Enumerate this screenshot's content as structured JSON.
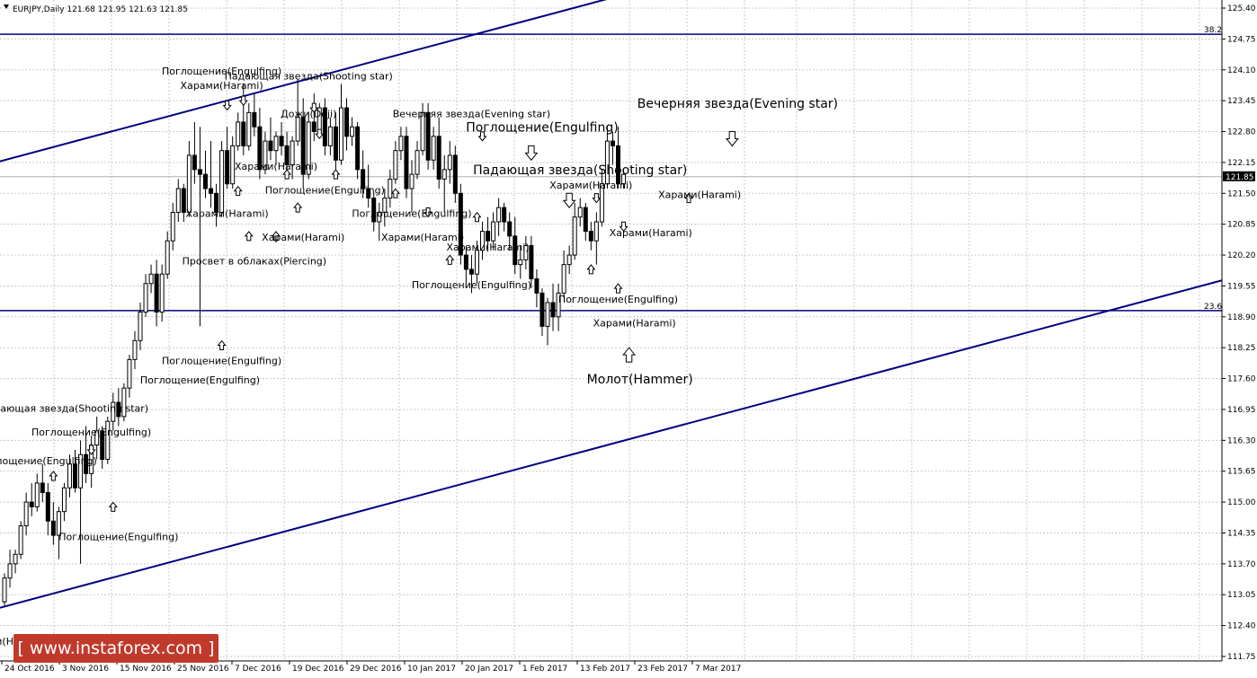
{
  "header": {
    "symbol_info": "EURJPY,Daily  121.68 121.95 121.63 121.85"
  },
  "watermark": {
    "text": "[ www.instaforex.com ]"
  },
  "colors": {
    "trendline": "#000080",
    "price_tag_bg": "#000000",
    "price_tag_fg": "#ffffff",
    "candle_up": "#ffffff",
    "candle_down": "#000000",
    "watermark_bg": "#c0392b"
  },
  "chart_data": {
    "type": "candlestick",
    "title": "",
    "ylim": [
      111.7,
      125.5
    ],
    "y_ticks": [
      "125.40",
      "124.75",
      "124.10",
      "123.45",
      "122.80",
      "122.15",
      "121.50",
      "120.85",
      "120.20",
      "119.55",
      "118.90",
      "118.25",
      "117.60",
      "116.95",
      "116.30",
      "115.65",
      "115.00",
      "114.35",
      "113.70",
      "113.05",
      "112.40",
      "111.75"
    ],
    "x_ticks": [
      "24 Oct 2016",
      "3 Nov 2016",
      "15 Nov 2016",
      "25 Nov 2016",
      "7 Dec 2016",
      "19 Dec 2016",
      "29 Dec 2016",
      "10 Jan 2017",
      "20 Jan 2017",
      "1 Feb 2017",
      "13 Feb 2017",
      "23 Feb 2017",
      "7 Mar 2017"
    ],
    "current_price": "121.85",
    "fib_levels": [
      {
        "label": "38.2",
        "price": 124.85
      },
      {
        "label": "23.6",
        "price": 119.03
      }
    ],
    "trend_channel": {
      "upper": [
        [
          0,
          122.2
        ],
        [
          108,
          125.5
        ]
      ],
      "lower": [
        [
          0,
          112.8
        ],
        [
          204,
          119.05
        ]
      ]
    },
    "candles": [
      [
        112.9,
        113.5,
        112.8,
        113.4
      ],
      [
        113.4,
        114.0,
        113.2,
        113.7
      ],
      [
        113.7,
        114.0,
        113.5,
        113.9
      ],
      [
        113.9,
        114.6,
        113.8,
        114.5
      ],
      [
        114.5,
        115.2,
        114.3,
        115.0
      ],
      [
        115.0,
        115.4,
        114.7,
        114.9
      ],
      [
        114.9,
        115.6,
        114.8,
        115.4
      ],
      [
        115.4,
        115.8,
        115.0,
        115.2
      ],
      [
        115.2,
        115.4,
        114.3,
        114.6
      ],
      [
        114.6,
        115.0,
        114.1,
        114.3
      ],
      [
        114.3,
        114.9,
        113.8,
        114.8
      ],
      [
        114.8,
        115.4,
        114.6,
        115.3
      ],
      [
        115.3,
        116.0,
        115.1,
        115.8
      ],
      [
        115.8,
        116.1,
        115.2,
        115.3
      ],
      [
        115.3,
        116.3,
        113.7,
        116.0
      ],
      [
        116.0,
        116.6,
        115.4,
        115.6
      ],
      [
        115.6,
        116.4,
        115.3,
        116.2
      ],
      [
        116.2,
        116.8,
        115.9,
        116.5
      ],
      [
        116.5,
        116.6,
        115.7,
        115.9
      ],
      [
        115.9,
        116.8,
        115.8,
        116.7
      ],
      [
        116.7,
        117.3,
        116.5,
        117.1
      ],
      [
        117.1,
        117.4,
        116.6,
        116.8
      ],
      [
        116.8,
        117.5,
        116.7,
        117.4
      ],
      [
        117.4,
        118.1,
        117.2,
        118.0
      ],
      [
        118.0,
        118.6,
        117.8,
        118.4
      ],
      [
        118.4,
        119.2,
        118.2,
        119.0
      ],
      [
        119.0,
        119.8,
        118.9,
        119.6
      ],
      [
        119.6,
        120.0,
        119.4,
        119.8
      ],
      [
        119.8,
        120.1,
        118.7,
        119.0
      ],
      [
        119.0,
        120.0,
        118.8,
        119.8
      ],
      [
        119.8,
        120.7,
        119.7,
        120.5
      ],
      [
        120.5,
        121.3,
        120.3,
        121.1
      ],
      [
        121.1,
        121.8,
        120.9,
        121.6
      ],
      [
        121.6,
        121.7,
        120.9,
        121.1
      ],
      [
        121.1,
        122.6,
        121.0,
        122.3
      ],
      [
        122.3,
        123.0,
        121.7,
        122.0
      ],
      [
        122.0,
        122.9,
        118.7,
        121.9
      ],
      [
        121.9,
        122.4,
        121.4,
        121.6
      ],
      [
        121.6,
        122.6,
        121.2,
        121.5
      ],
      [
        121.5,
        121.7,
        120.8,
        121.1
      ],
      [
        121.1,
        122.6,
        121.0,
        122.4
      ],
      [
        122.4,
        122.9,
        121.6,
        121.7
      ],
      [
        121.7,
        122.7,
        121.6,
        122.5
      ],
      [
        122.5,
        123.2,
        122.4,
        123.0
      ],
      [
        123.0,
        123.8,
        122.3,
        122.5
      ],
      [
        122.5,
        123.4,
        122.4,
        123.2
      ],
      [
        123.2,
        123.6,
        122.7,
        122.9
      ],
      [
        122.9,
        123.3,
        121.8,
        122.0
      ],
      [
        122.0,
        122.8,
        121.9,
        122.6
      ],
      [
        122.6,
        123.1,
        122.2,
        122.4
      ],
      [
        122.4,
        122.8,
        122.1,
        122.7
      ],
      [
        122.7,
        123.0,
        122.3,
        122.5
      ],
      [
        122.5,
        122.8,
        121.9,
        122.1
      ],
      [
        122.1,
        122.7,
        121.8,
        122.6
      ],
      [
        122.6,
        123.9,
        122.5,
        123.1
      ],
      [
        123.1,
        123.5,
        121.6,
        121.9
      ],
      [
        121.9,
        123.2,
        121.8,
        123.0
      ],
      [
        123.0,
        123.6,
        122.6,
        122.8
      ],
      [
        122.8,
        123.4,
        122.7,
        123.3
      ],
      [
        123.3,
        123.5,
        122.3,
        122.5
      ],
      [
        122.5,
        123.1,
        122.3,
        122.9
      ],
      [
        122.9,
        123.2,
        122.0,
        122.2
      ],
      [
        122.2,
        123.8,
        122.1,
        123.3
      ],
      [
        123.3,
        123.5,
        122.4,
        122.7
      ],
      [
        122.7,
        123.1,
        122.5,
        122.9
      ],
      [
        122.9,
        123.0,
        121.8,
        122.0
      ],
      [
        122.0,
        122.4,
        121.4,
        121.6
      ],
      [
        121.6,
        122.1,
        121.2,
        121.4
      ],
      [
        121.4,
        121.5,
        120.7,
        120.9
      ],
      [
        120.9,
        121.3,
        120.5,
        121.1
      ],
      [
        121.1,
        121.6,
        120.8,
        121.4
      ],
      [
        121.4,
        122.0,
        121.2,
        121.8
      ],
      [
        121.8,
        122.6,
        121.7,
        122.4
      ],
      [
        122.4,
        122.9,
        122.2,
        122.7
      ],
      [
        122.7,
        122.9,
        121.4,
        121.6
      ],
      [
        121.6,
        122.2,
        121.1,
        121.9
      ],
      [
        121.9,
        122.6,
        121.8,
        122.4
      ],
      [
        122.4,
        123.4,
        122.3,
        123.2
      ],
      [
        123.2,
        123.4,
        122.0,
        122.2
      ],
      [
        122.2,
        122.9,
        122.0,
        122.7
      ],
      [
        122.7,
        123.1,
        121.6,
        121.8
      ],
      [
        121.8,
        122.3,
        121.1,
        122.0
      ],
      [
        122.0,
        122.6,
        121.7,
        122.3
      ],
      [
        122.3,
        122.5,
        121.3,
        121.5
      ],
      [
        121.5,
        121.7,
        120.0,
        120.2
      ],
      [
        120.2,
        120.4,
        119.6,
        119.9
      ],
      [
        119.9,
        120.2,
        119.4,
        119.8
      ],
      [
        119.8,
        120.5,
        119.6,
        120.3
      ],
      [
        120.3,
        120.9,
        120.1,
        120.7
      ],
      [
        120.7,
        121.0,
        120.3,
        120.5
      ],
      [
        120.5,
        121.1,
        120.3,
        120.9
      ],
      [
        120.9,
        121.4,
        120.6,
        121.2
      ],
      [
        121.2,
        121.3,
        120.7,
        120.9
      ],
      [
        120.9,
        121.1,
        120.3,
        120.6
      ],
      [
        120.6,
        121.0,
        119.8,
        120.0
      ],
      [
        120.0,
        120.4,
        119.7,
        120.1
      ],
      [
        120.1,
        120.6,
        119.9,
        120.4
      ],
      [
        120.4,
        120.6,
        119.5,
        119.7
      ],
      [
        119.7,
        119.9,
        119.1,
        119.4
      ],
      [
        119.4,
        119.5,
        118.5,
        118.7
      ],
      [
        118.7,
        119.3,
        118.3,
        119.2
      ],
      [
        119.2,
        119.6,
        118.6,
        118.9
      ],
      [
        118.9,
        119.6,
        118.6,
        119.4
      ],
      [
        119.4,
        120.3,
        119.3,
        120.0
      ],
      [
        120.0,
        120.4,
        119.8,
        120.2
      ],
      [
        120.2,
        121.3,
        120.1,
        121.0
      ],
      [
        121.0,
        121.4,
        120.8,
        121.2
      ],
      [
        121.2,
        121.3,
        120.5,
        120.7
      ],
      [
        120.7,
        120.9,
        120.3,
        120.5
      ],
      [
        120.5,
        121.1,
        120.0,
        120.9
      ],
      [
        120.9,
        122.0,
        120.8,
        121.7
      ],
      [
        121.7,
        122.9,
        121.6,
        122.6
      ],
      [
        122.6,
        122.8,
        122.1,
        122.5
      ],
      [
        122.5,
        122.9,
        121.6,
        121.7
      ],
      [
        121.7,
        122.0,
        121.6,
        121.9
      ]
    ],
    "annotations": [
      {
        "text": "Поглощение(Engulfing)",
        "candle": 40,
        "price": 124.0,
        "size": "small"
      },
      {
        "text": "Харами(Harami)",
        "candle": 40,
        "price": 123.7,
        "size": "small"
      },
      {
        "text": "Падающая звезда(Shooting star)",
        "candle": 56,
        "price": 123.9,
        "size": "small"
      },
      {
        "text": "Дожи(Doji)",
        "candle": 56,
        "price": 123.1,
        "size": "small"
      },
      {
        "text": "Вечерняя звезда(Evening star)",
        "candle": 86,
        "price": 123.1,
        "size": "small"
      },
      {
        "text": "Поглощение(Engulfing)",
        "candle": 99,
        "price": 122.8,
        "size": "big"
      },
      {
        "text": "Вечерняя звезда(Evening star)",
        "candle": 135,
        "price": 123.3,
        "size": "big"
      },
      {
        "text": "Падающая звезда(Shooting star)",
        "candle": 106,
        "price": 121.9,
        "size": "big"
      },
      {
        "text": "Харами(Harami)",
        "candle": 50,
        "price": 122.0,
        "size": "small"
      },
      {
        "text": "Харами(Harami)",
        "candle": 108,
        "price": 121.6,
        "size": "small"
      },
      {
        "text": "Харами(Harami)",
        "candle": 128,
        "price": 121.4,
        "size": "small"
      },
      {
        "text": "Поглощение(Engulfing)",
        "candle": 59,
        "price": 121.5,
        "size": "small"
      },
      {
        "text": "Харами(Harami)",
        "candle": 41,
        "price": 121.0,
        "size": "small"
      },
      {
        "text": "Поглощение(Engulfing)",
        "candle": 75,
        "price": 121.0,
        "size": "small"
      },
      {
        "text": "Харами(Harami)",
        "candle": 55,
        "price": 120.5,
        "size": "small"
      },
      {
        "text": "Харами(Harami)",
        "candle": 77,
        "price": 120.5,
        "size": "small"
      },
      {
        "text": "Харами(Harami)",
        "candle": 119,
        "price": 120.6,
        "size": "small"
      },
      {
        "text": "Харами(Harami)",
        "candle": 89,
        "price": 120.3,
        "size": "small"
      },
      {
        "text": "Просвет в облаках(Piercing)",
        "candle": 46,
        "price": 120.0,
        "size": "small"
      },
      {
        "text": "Поглощение(Engulfing)",
        "candle": 86,
        "price": 119.5,
        "size": "small"
      },
      {
        "text": "Поглощение(Engulfing)",
        "candle": 113,
        "price": 119.2,
        "size": "small"
      },
      {
        "text": "Харами(Harami)",
        "candle": 116,
        "price": 118.7,
        "size": "small"
      },
      {
        "text": "Поглощение(Engulfing)",
        "candle": 40,
        "price": 117.9,
        "size": "small"
      },
      {
        "text": "Поглощение(Engulfing)",
        "candle": 36,
        "price": 117.5,
        "size": "small"
      },
      {
        "text": "Молот(Hammer)",
        "candle": 117,
        "price": 117.5,
        "size": "big"
      },
      {
        "text": "Падающая звезда(Shooting star)",
        "candle": 11,
        "price": 116.9,
        "size": "small"
      },
      {
        "text": "Поглощение(Engulfing)",
        "candle": 16,
        "price": 116.4,
        "size": "small"
      },
      {
        "text": "Поглощение(Engulfing)",
        "candle": 6,
        "price": 115.8,
        "size": "small"
      },
      {
        "text": "Поглощение(Engulfing)",
        "candle": 21,
        "price": 114.2,
        "size": "small"
      },
      {
        "text": "Харами(Harami)",
        "candle": 0,
        "price": 112.0,
        "size": "small"
      }
    ],
    "arrows": [
      {
        "candle": 41,
        "price": 123.35,
        "dir": "down",
        "size": "small"
      },
      {
        "candle": 44,
        "price": 123.45,
        "dir": "down",
        "size": "small"
      },
      {
        "candle": 57,
        "price": 123.3,
        "dir": "down",
        "size": "small"
      },
      {
        "candle": 58,
        "price": 122.75,
        "dir": "down",
        "size": "small"
      },
      {
        "candle": 88,
        "price": 122.7,
        "dir": "down",
        "size": "small"
      },
      {
        "candle": 97,
        "price": 122.35,
        "dir": "down",
        "size": "big"
      },
      {
        "candle": 134,
        "price": 122.65,
        "dir": "down",
        "size": "big"
      },
      {
        "candle": 104,
        "price": 121.35,
        "dir": "down",
        "size": "big"
      },
      {
        "candle": 109,
        "price": 121.4,
        "dir": "down",
        "size": "small"
      },
      {
        "candle": 126,
        "price": 121.4,
        "dir": "up",
        "size": "small"
      },
      {
        "candle": 52,
        "price": 121.9,
        "dir": "up",
        "size": "small"
      },
      {
        "candle": 61,
        "price": 121.9,
        "dir": "up",
        "size": "small"
      },
      {
        "candle": 43,
        "price": 121.55,
        "dir": "up",
        "size": "small"
      },
      {
        "candle": 54,
        "price": 121.2,
        "dir": "up",
        "size": "small"
      },
      {
        "candle": 72,
        "price": 121.5,
        "dir": "up",
        "size": "small"
      },
      {
        "candle": 78,
        "price": 121.1,
        "dir": "down",
        "size": "small"
      },
      {
        "candle": 87,
        "price": 121.0,
        "dir": "up",
        "size": "small"
      },
      {
        "candle": 45,
        "price": 120.6,
        "dir": "up",
        "size": "small"
      },
      {
        "candle": 50,
        "price": 120.6,
        "dir": "up",
        "size": "small"
      },
      {
        "candle": 114,
        "price": 120.8,
        "dir": "down",
        "size": "small"
      },
      {
        "candle": 82,
        "price": 120.1,
        "dir": "up",
        "size": "small"
      },
      {
        "candle": 108,
        "price": 119.9,
        "dir": "up",
        "size": "small"
      },
      {
        "candle": 113,
        "price": 119.5,
        "dir": "up",
        "size": "small"
      },
      {
        "candle": 40,
        "price": 118.3,
        "dir": "up",
        "size": "small"
      },
      {
        "candle": 115,
        "price": 118.1,
        "dir": "up",
        "size": "big"
      },
      {
        "candle": 16,
        "price": 116.1,
        "dir": "down",
        "size": "small"
      },
      {
        "candle": 9,
        "price": 115.55,
        "dir": "up",
        "size": "small"
      },
      {
        "candle": 20,
        "price": 114.9,
        "dir": "up",
        "size": "small"
      }
    ]
  }
}
